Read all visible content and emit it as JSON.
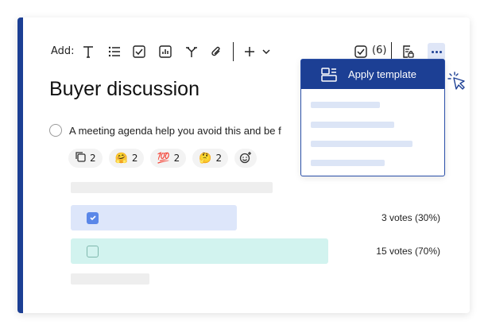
{
  "toolbar": {
    "add_label": "Add:",
    "icons": [
      "text-icon",
      "list-icon",
      "checkbox-icon",
      "chart-icon",
      "branch-icon",
      "paperclip-icon",
      "plus-icon",
      "chevron-down-icon",
      "task-check-icon",
      "document-lock-icon",
      "more-icon"
    ],
    "task_count": "(6)"
  },
  "page": {
    "title": "Buyer discussion",
    "agenda_text": "A meeting agenda help you avoid this and be f"
  },
  "reactions": [
    {
      "icon": "copy-icon",
      "count": "2"
    },
    {
      "emoji": "🤗",
      "count": "2"
    },
    {
      "emoji": "💯",
      "count": "2"
    },
    {
      "emoji": "🤔",
      "count": "2"
    }
  ],
  "poll": {
    "options": [
      {
        "checked": true,
        "votes": "3 votes (30%)",
        "share": 0.3
      },
      {
        "checked": false,
        "votes": "15 votes (70%)",
        "share": 0.7
      }
    ]
  },
  "menu": {
    "items": [
      {
        "label": "Apply template",
        "icon": "template-icon"
      }
    ]
  },
  "colors": {
    "accent": "#1c3f94",
    "option1": "#dde6fa",
    "option2": "#d2f3ef"
  }
}
